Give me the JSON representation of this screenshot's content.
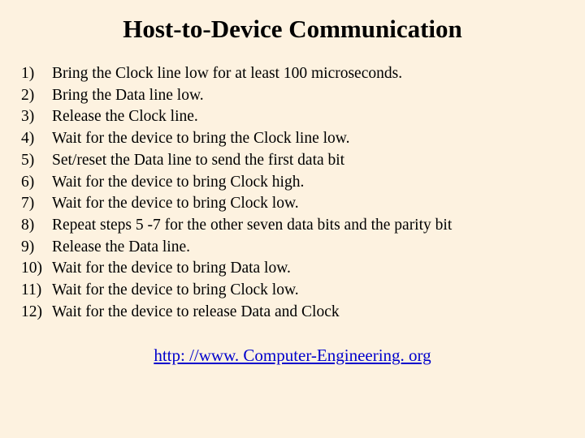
{
  "title": "Host-to-Device Communication",
  "items": [
    {
      "num": "1)",
      "text": "Bring the Clock line low for at least 100 microseconds."
    },
    {
      "num": "2)",
      "text": "Bring the Data line low."
    },
    {
      "num": "3)",
      "text": "Release the Clock line."
    },
    {
      "num": "4)",
      "text": "Wait for the device to bring the Clock line low."
    },
    {
      "num": "5)",
      "text": "Set/reset the Data line to send the first data bit"
    },
    {
      "num": "6)",
      "text": "Wait for the device to bring Clock high."
    },
    {
      "num": "7)",
      "text": "Wait for the device to bring Clock low."
    },
    {
      "num": "8)",
      "text": "Repeat steps 5 -7 for the other seven data bits and the parity bit"
    },
    {
      "num": "9)",
      "text": "Release the Data line."
    },
    {
      "num": "10)",
      "text": "Wait for the device to bring Data low."
    },
    {
      "num": "11)",
      "text": "Wait for the device to bring Clock  low."
    },
    {
      "num": "12)",
      "text": "Wait for the device to release Data and Clock"
    }
  ],
  "footer_link": "http: //www. Computer-Engineering. org"
}
